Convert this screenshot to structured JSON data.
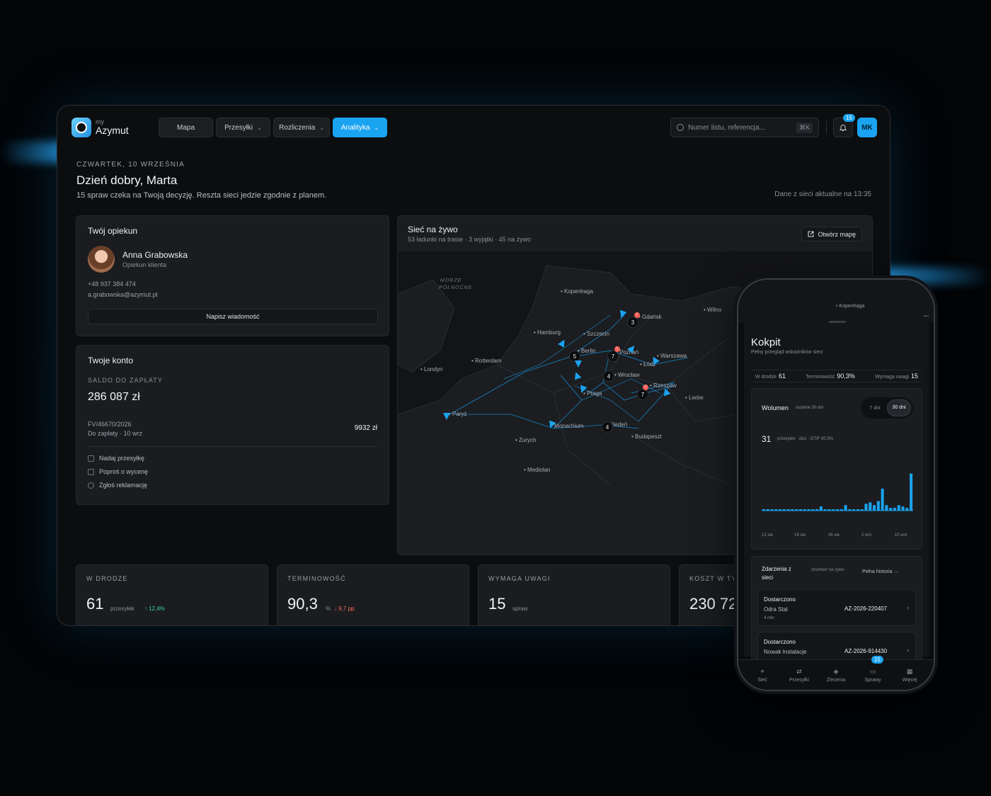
{
  "desktop": {
    "brand_small": "my",
    "brand": "Azymut",
    "nav": [
      "Mapa",
      "Przesyłki",
      "Rozliczenia",
      "Analityka"
    ],
    "search_placeholder": "Numer listu, referencja...",
    "search_shortcut": "⌘K",
    "notifications_badge": "15",
    "user_initials": "MK",
    "date": "CZWARTEK, 10 WRZEŚNIA",
    "greeting": "Dzień dobry, Marta",
    "subtitle": "15 spraw czeka na Twoją decyzję. Reszta sieci jedzie zgodnie z planem.",
    "updated": "Dane z sieci aktualne na 13:35",
    "guardian": {
      "title": "Twój opiekun",
      "name": "Anna Grabowska",
      "role": "Opiekun klienta",
      "phone": "+48 937 384 474",
      "email": "a.grabowska@azymut.pl",
      "button": "Napisz wiadomość"
    },
    "account": {
      "title": "Twoje konto",
      "balance_label": "SALDO DO ZAPŁATY",
      "balance": "286 087 zł",
      "invoice": "FV/46670/2026",
      "invoice_due": "Do zapłaty · 10 wrz",
      "invoice_amount": "9932 zł",
      "actions": [
        "Nadaj przesyłkę",
        "Poproś o wycenę",
        "Zgłoś reklamację"
      ]
    },
    "map": {
      "title": "Sieć na żywo",
      "subtitle": "53 ładunki na trasie · 3 wyjątki · 45 na żywo",
      "open_button": "Otwórz mapę",
      "sea_label_1": "MORZE",
      "sea_label_2": "PÓŁNOCNE",
      "cities": [
        "Kopenhaga",
        "Wilno",
        "Hamburg",
        "Szczecin",
        "Gdańsk",
        "Rotterdam",
        "Londyn",
        "Berlin",
        "Poznań",
        "Warszawa",
        "Łódź",
        "Wrocław",
        "Rzeszów",
        "Lwów",
        "Praga",
        "Paryż",
        "Monachium",
        "Wiedeń",
        "Zurych",
        "Budapeszt",
        "Mediolan"
      ],
      "clusters": [
        "3",
        "5",
        "7",
        "4",
        "7",
        "4"
      ],
      "alert_markers": [
        "!",
        "!",
        "!"
      ]
    },
    "kpis": [
      {
        "label": "W DRODZE",
        "value": "61",
        "unit": "przesyłek",
        "delta": "↑ 12,4%",
        "trend": "up"
      },
      {
        "label": "TERMINOWOŚĆ",
        "value": "90,3",
        "unit": "%",
        "delta": "↓ 9,7 pp",
        "trend": "down"
      },
      {
        "label": "WYMAGA UWAGI",
        "value": "15",
        "unit": "spraw",
        "delta": "",
        "trend": ""
      },
      {
        "label": "KOSZT W TYM",
        "value": "230 72",
        "unit": "",
        "delta": "",
        "trend": ""
      }
    ]
  },
  "phone": {
    "map_label": "Kopenhaga",
    "map_label_2": "W",
    "title": "Kokpit",
    "subtitle": "Pełny przegląd wskaźników sieci",
    "stats": [
      {
        "label": "W drodze",
        "value": "61"
      },
      {
        "label": "Terminowość",
        "value": "90,3%"
      },
      {
        "label": "Wymaga uwagi",
        "value": "15"
      }
    ],
    "volume": {
      "title": "Wolumen",
      "period": "ostatnie 30 dni",
      "toggle": [
        "7 dni",
        "30 dni"
      ],
      "value": "31",
      "value_note": "przesyłek · dziś · OTIF 90,3%"
    },
    "chart_data": {
      "type": "bar",
      "x": [
        "12 sie",
        "19 sie",
        "26 sie",
        "2 wrz",
        "10 wrz"
      ],
      "tick_labels": [
        "12 sie",
        "19 sie",
        "26 sie",
        "2 wrz",
        "10 wrz"
      ],
      "values": [
        1,
        1,
        1,
        1,
        1,
        1,
        1,
        1,
        1,
        1,
        1,
        1,
        1,
        1,
        3,
        1,
        1,
        1,
        1,
        1,
        4,
        1,
        1,
        1,
        1,
        5,
        6,
        4,
        7,
        16,
        4,
        2,
        2,
        4,
        3,
        2,
        27
      ],
      "ylim": [
        0,
        31
      ],
      "title": "",
      "xlabel": "",
      "ylabel": "",
      "grid": false,
      "color": "#1aa3f0"
    },
    "events": {
      "title": "Zdarzenia z sieci",
      "note": "strumień na żywo",
      "link": "Pełna historia",
      "items": [
        {
          "status": "Dostarczono",
          "client": "Odra Stal",
          "time": "4 min",
          "id": "AZ-2026-220407"
        },
        {
          "status": "Dostarczono",
          "client": "Nowak Instalacje",
          "time": "",
          "id": "AZ-2026-914430"
        }
      ]
    },
    "tabs": [
      "Sieć",
      "Przesyłki",
      "Zlecenia",
      "Sprawy",
      "Więcej"
    ],
    "tab_badge": "15"
  },
  "colors": {
    "accent": "#1aa3f0",
    "positive": "#38d39f",
    "negative": "#ff6b5e",
    "alert": "#ff5f56"
  }
}
